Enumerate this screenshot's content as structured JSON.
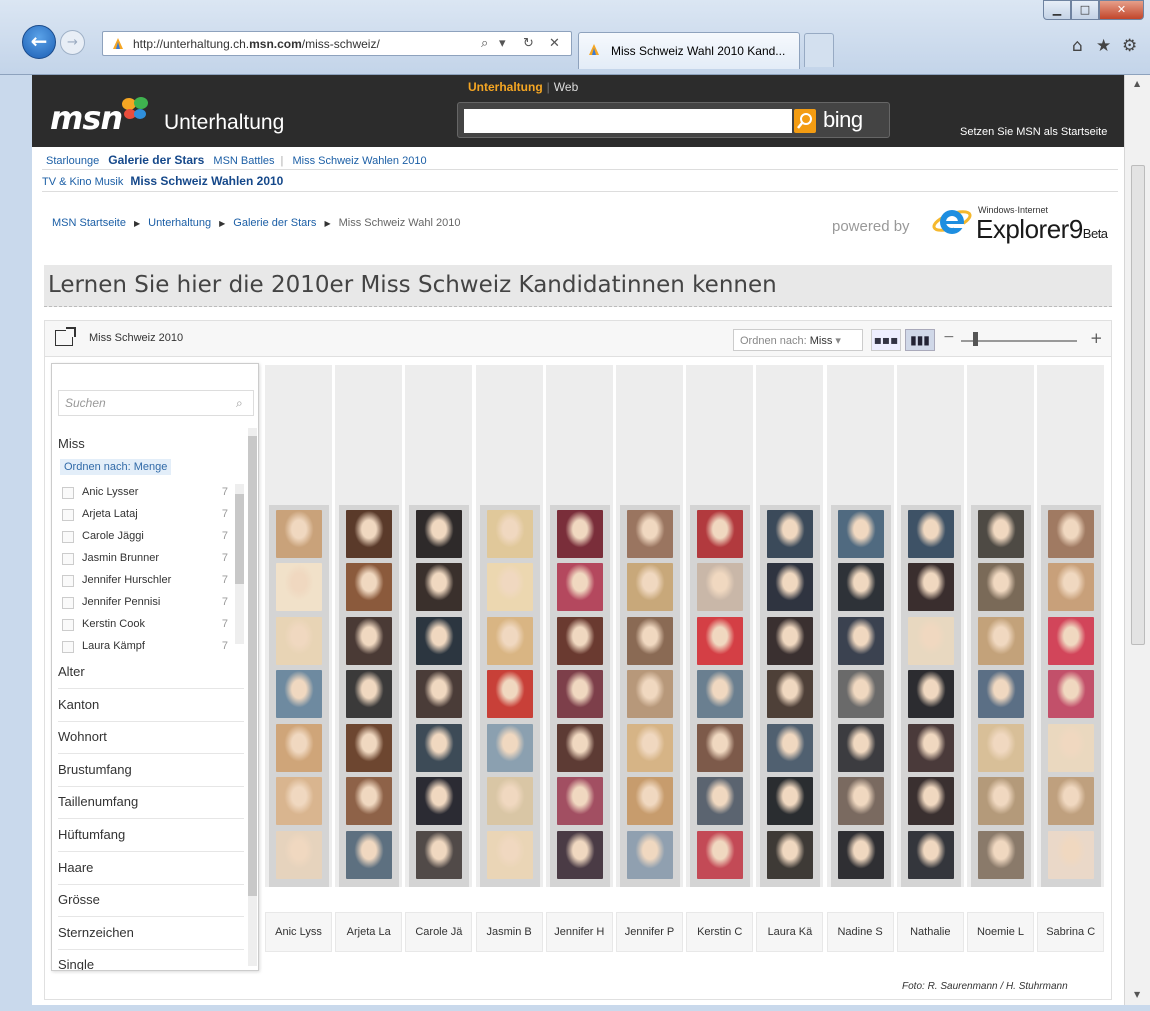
{
  "browser": {
    "url_prefix": "http://unterhaltung.ch.",
    "url_bold": "msn.com",
    "url_suffix": "/miss-schweiz/",
    "tab_title": "Miss Schweiz Wahl 2010 Kand...",
    "nav_back": "←",
    "nav_forward": "→",
    "addr_search": "⌕",
    "addr_dropdown": "▾",
    "addr_refresh": "↻",
    "addr_stop": "✕",
    "win_min": "▁",
    "win_max": "□",
    "win_close": "✕",
    "home_glyph": "⌂",
    "favorites_glyph": "★",
    "tools_glyph": "⚙"
  },
  "header": {
    "logo": "msn",
    "section": "Unterhaltung",
    "search_tabs": [
      "Unterhaltung",
      "Web"
    ],
    "search_divider": "|",
    "search_brand": "bing",
    "startseite": "Setzen Sie MSN als Startseite"
  },
  "nav": {
    "primary": [
      "Starlounge",
      "Galerie der Stars",
      "MSN Battles",
      "Miss Schweiz Wahlen 2010"
    ],
    "primary_divider": "|",
    "secondary": [
      "TV & Kino",
      "Musik",
      "Miss Schweiz Wahlen 2010"
    ],
    "breadcrumb": [
      "MSN Startseite",
      "Unterhaltung",
      "Galerie der Stars",
      "Miss Schweiz Wahl 2010"
    ],
    "breadcrumb_sep": "▶"
  },
  "powered": {
    "label": "powered by",
    "product_small": "Windows·Internet",
    "product": "Explorer",
    "version": "9",
    "beta": "Beta"
  },
  "headline": "Lernen Sie hier die 2010er Miss Schweiz Kandidatinnen kennen",
  "viewer": {
    "collection": "Miss Schweiz 2010",
    "sort_label": "Ordnen nach:",
    "sort_value": "Miss",
    "sort_arrow": "▾",
    "grid_view_glyph": "▪▪▪",
    "histogram_view_glyph": "▮▮▮",
    "zoom_minus": "−",
    "zoom_plus": "+",
    "zoom_level": 0.1
  },
  "filter": {
    "search_placeholder": "Suchen",
    "search_glyph": "⌕",
    "open_category": "Miss",
    "order_label": "Ordnen nach: Menge",
    "items": [
      {
        "name": "Anic Lysser",
        "count": "7"
      },
      {
        "name": "Arjeta Lataj",
        "count": "7"
      },
      {
        "name": "Carole Jäggi",
        "count": "7"
      },
      {
        "name": "Jasmin Brunner",
        "count": "7"
      },
      {
        "name": "Jennifer Hurschler",
        "count": "7"
      },
      {
        "name": "Jennifer Pennisi",
        "count": "7"
      },
      {
        "name": "Kerstin Cook",
        "count": "7"
      },
      {
        "name": "Laura Kämpf",
        "count": "7"
      }
    ],
    "categories": [
      "Alter",
      "Kanton",
      "Wohnort",
      "Brustumfang",
      "Taillenumfang",
      "Hüftumfang",
      "Haare",
      "Grösse",
      "Sternzeichen",
      "Single"
    ]
  },
  "columns": [
    "Anic Lyss",
    "Arjeta La",
    "Carole Jä",
    "Jasmin B",
    "Jennifer H",
    "Jennifer P",
    "Kerstin C",
    "Laura Kä",
    "Nadine S",
    "Nathalie",
    "Noemie L",
    "Sabrina C"
  ],
  "photos_per_column": 7,
  "photo_credit": "Foto: R. Saurenmann / H. Stuhrmann"
}
